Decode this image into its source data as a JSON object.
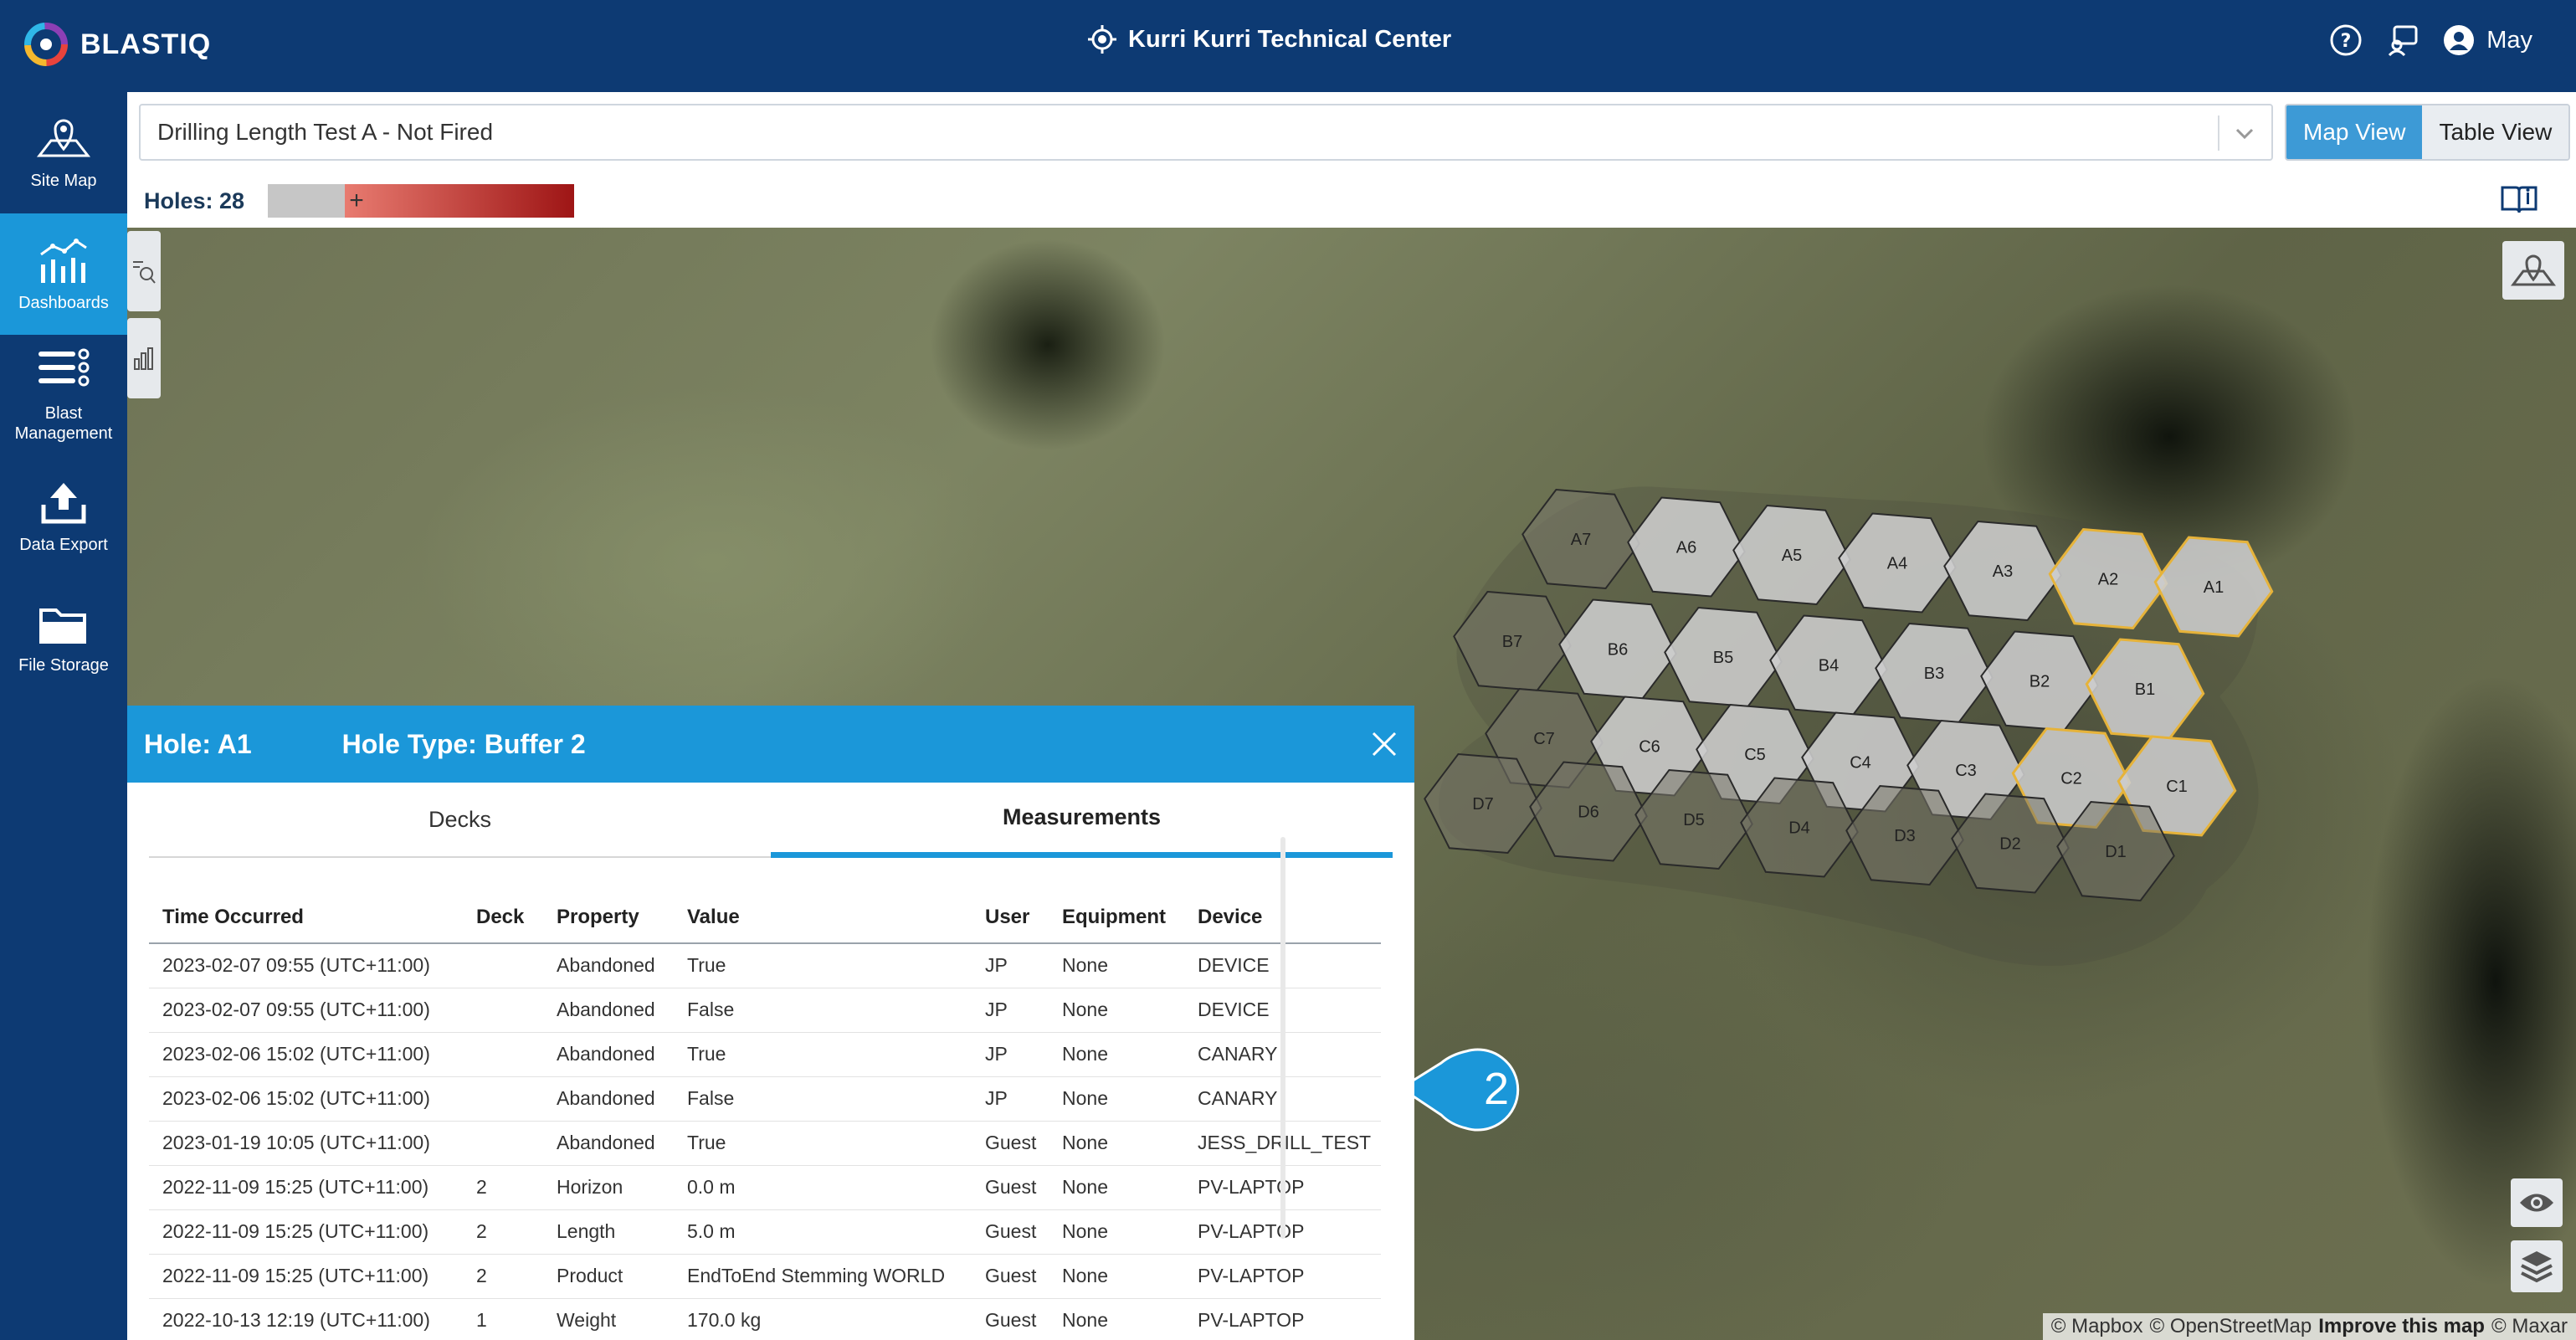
{
  "app": {
    "name": "BLASTIQ"
  },
  "site": {
    "title": "Kurri Kurri Technical Center"
  },
  "user": {
    "name": "May"
  },
  "colors": {
    "primary": "#0d3a73",
    "accent": "#1b97d9",
    "hole_border_selected": "#e6b33a"
  },
  "sidebar": {
    "items": [
      {
        "label": "Site Map",
        "icon": "map-pin-icon"
      },
      {
        "label": "Dashboards",
        "icon": "dashboard-chart-icon"
      },
      {
        "label": "Blast Management",
        "icon": "list-icon"
      },
      {
        "label": "Data Export",
        "icon": "upload-icon"
      },
      {
        "label": "File Storage",
        "icon": "folder-icon"
      }
    ]
  },
  "header": {
    "blast_select": "Drilling Length Test A - Not Fired",
    "view_map": "Map View",
    "view_table": "Table View",
    "holes_label": "Holes: 28",
    "legend_plus": "+"
  },
  "map": {
    "holes": [
      "A7",
      "A6",
      "A5",
      "A4",
      "A3",
      "A2",
      "A1",
      "B7",
      "B6",
      "B5",
      "B4",
      "B3",
      "B2",
      "B1",
      "C7",
      "C6",
      "C5",
      "C4",
      "C3",
      "C2",
      "C1",
      "D7",
      "D6",
      "D5",
      "D4",
      "D3",
      "D2",
      "D1"
    ],
    "callout_number": "2",
    "attribution": {
      "mapbox": "© Mapbox",
      "osm": "© OpenStreetMap",
      "improve": "Improve this map",
      "maxar": "© Maxar"
    }
  },
  "panel": {
    "hole_label": "Hole: A1",
    "hole_type": "Hole Type: Buffer 2",
    "tabs": [
      "Decks",
      "Measurements"
    ],
    "columns": [
      "Time Occurred",
      "Deck",
      "Property",
      "Value",
      "User",
      "Equipment",
      "Device"
    ],
    "rows": [
      [
        "2023-02-07 09:55 (UTC+11:00)",
        "",
        "Abandoned",
        "True",
        "JP",
        "None",
        "DEVICE"
      ],
      [
        "2023-02-07 09:55 (UTC+11:00)",
        "",
        "Abandoned",
        "False",
        "JP",
        "None",
        "DEVICE"
      ],
      [
        "2023-02-06 15:02 (UTC+11:00)",
        "",
        "Abandoned",
        "True",
        "JP",
        "None",
        "CANARY"
      ],
      [
        "2023-02-06 15:02 (UTC+11:00)",
        "",
        "Abandoned",
        "False",
        "JP",
        "None",
        "CANARY"
      ],
      [
        "2023-01-19 10:05 (UTC+11:00)",
        "",
        "Abandoned",
        "True",
        "Guest",
        "None",
        "JESS_DRILL_TEST"
      ],
      [
        "2022-11-09 15:25 (UTC+11:00)",
        "2",
        "Horizon",
        "0.0 m",
        "Guest",
        "None",
        "PV-LAPTOP"
      ],
      [
        "2022-11-09 15:25 (UTC+11:00)",
        "2",
        "Length",
        "5.0 m",
        "Guest",
        "None",
        "PV-LAPTOP"
      ],
      [
        "2022-11-09 15:25 (UTC+11:00)",
        "2",
        "Product",
        "EndToEnd Stemming WORLD",
        "Guest",
        "None",
        "PV-LAPTOP"
      ],
      [
        "2022-10-13 12:19 (UTC+11:00)",
        "1",
        "Weight",
        "170.0 kg",
        "Guest",
        "None",
        "PV-LAPTOP"
      ]
    ]
  }
}
